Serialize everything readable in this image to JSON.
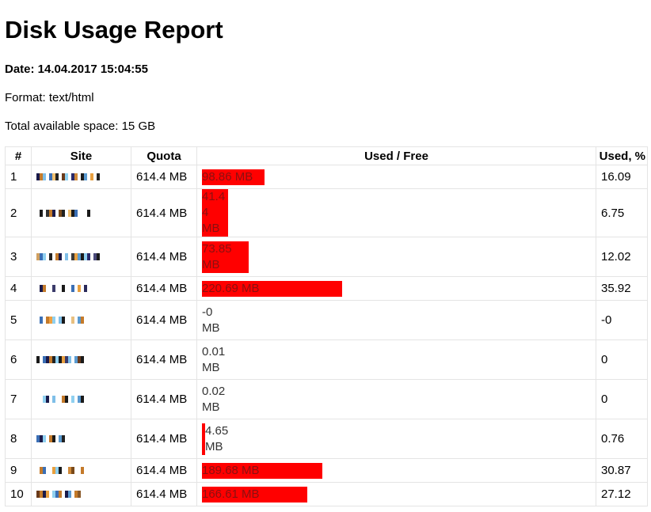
{
  "report": {
    "title": "Disk Usage Report",
    "date": "Date: 14.04.2017 15:04:55",
    "format": "Format: text/html",
    "total": "Total available space: 15 GB"
  },
  "table": {
    "headers": [
      "#",
      "Site",
      "Quota",
      "Used / Free",
      "Used, %"
    ],
    "rows": [
      {
        "num": "1",
        "quota": "614.4 MB",
        "used": "98.86 MB",
        "pct": "16.09",
        "fraction": 0.1609,
        "tall": false
      },
      {
        "num": "2",
        "quota": "614.4 MB",
        "used": "41.44 MB",
        "pct": "6.75",
        "fraction": 0.0675,
        "tall": true
      },
      {
        "num": "3",
        "quota": "614.4 MB",
        "used": "73.85 MB",
        "pct": "12.02",
        "fraction": 0.1202,
        "tall": true
      },
      {
        "num": "4",
        "quota": "614.4 MB",
        "used": "220.69 MB",
        "pct": "35.92",
        "fraction": 0.3592,
        "tall": false
      },
      {
        "num": "5",
        "quota": "614.4 MB",
        "used": "-0 MB",
        "pct": "-0",
        "fraction": 0,
        "tall": true
      },
      {
        "num": "6",
        "quota": "614.4 MB",
        "used": "0.01 MB",
        "pct": "0",
        "fraction": 0,
        "tall": true
      },
      {
        "num": "7",
        "quota": "614.4 MB",
        "used": "0.02 MB",
        "pct": "0",
        "fraction": 0,
        "tall": true
      },
      {
        "num": "8",
        "quota": "614.4 MB",
        "used": "4.65 MB",
        "pct": "0.76",
        "fraction": 0.0076,
        "tall": true
      },
      {
        "num": "9",
        "quota": "614.4 MB",
        "used": "189.68 MB",
        "pct": "30.87",
        "fraction": 0.3087,
        "tall": false
      },
      {
        "num": "10",
        "quota": "614.4 MB",
        "used": "166.61 MB",
        "pct": "27.12",
        "fraction": 0.2712,
        "tall": false
      }
    ]
  },
  "colors": {
    "bar": "#ff0000",
    "border": "#e4e4e4"
  },
  "site_pixel_icons": "pixelated-site-name-redaction"
}
